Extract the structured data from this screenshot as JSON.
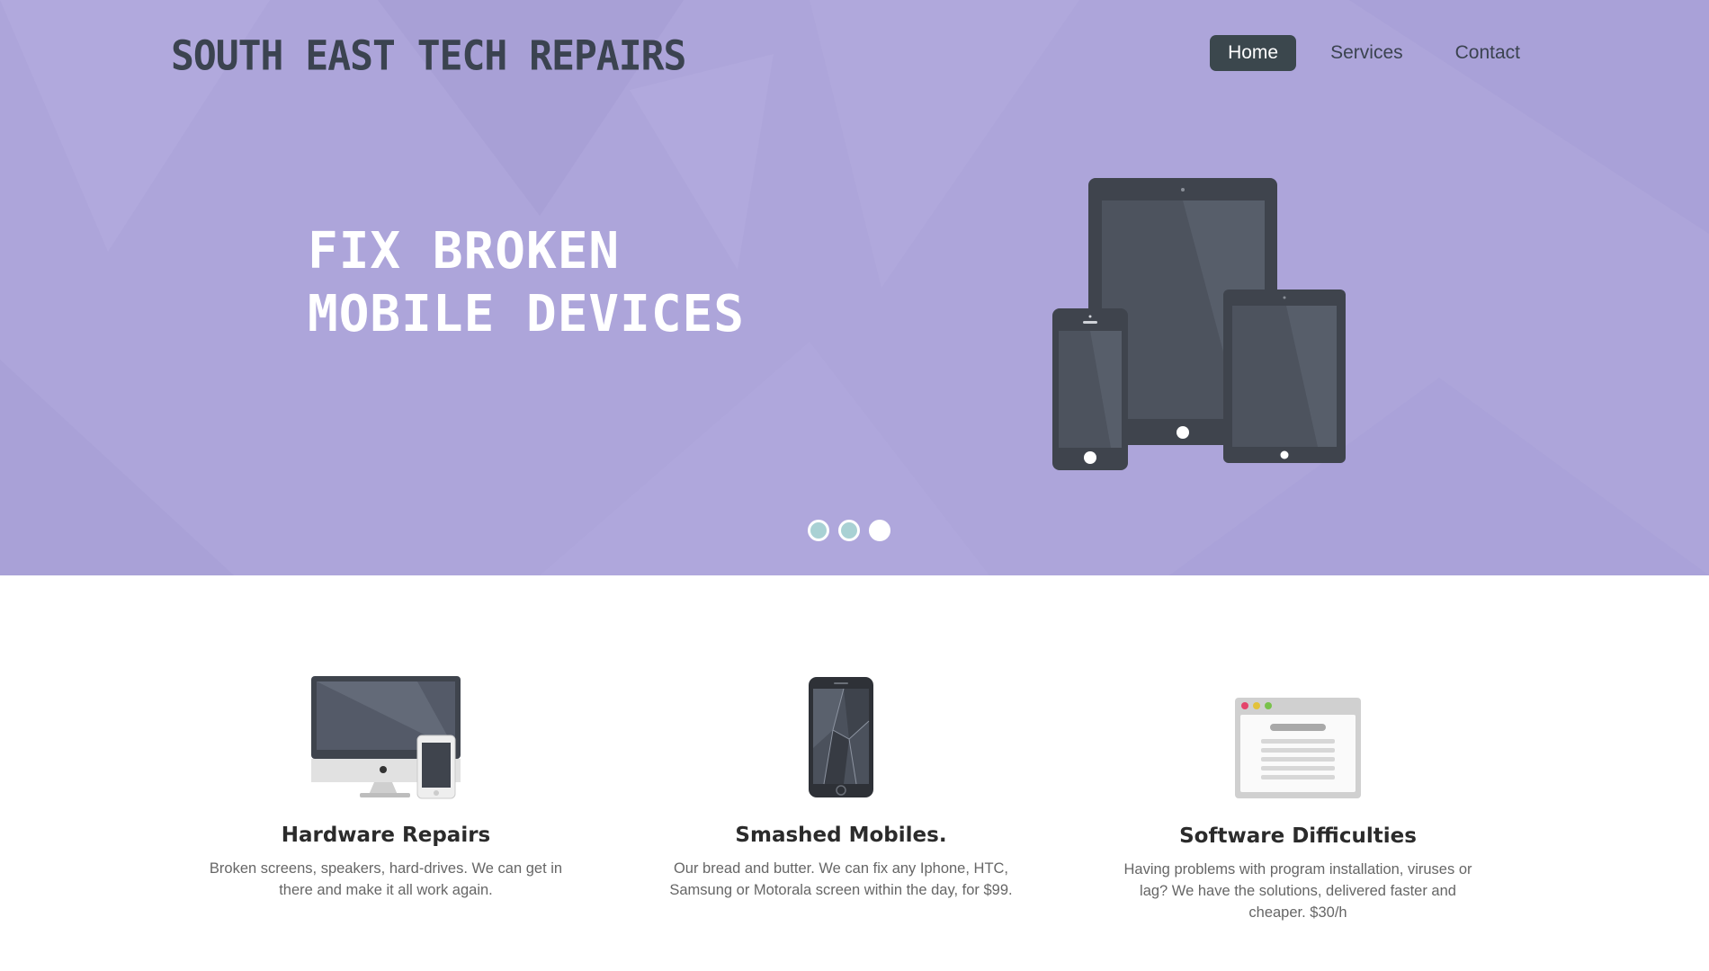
{
  "header": {
    "brand": "SOUTH EAST TECH REPAIRS",
    "nav": [
      {
        "label": "Home",
        "active": true
      },
      {
        "label": "Services",
        "active": false
      },
      {
        "label": "Contact",
        "active": false
      }
    ]
  },
  "hero": {
    "headline_line1": "FIX BROKEN",
    "headline_line2": "MOBILE DEVICES",
    "illustration_icon": "devices-icon",
    "slider": {
      "count": 3,
      "active_index": 2
    },
    "colors": {
      "background": "#ada5da",
      "headline": "#ffffff",
      "dot": "#a9d1d4"
    }
  },
  "features": [
    {
      "icon": "desktop-and-phone-icon",
      "title": "Hardware Repairs",
      "text": "Broken screens, speakers, hard-drives. We can get in there and make it all work again."
    },
    {
      "icon": "smashed-phone-icon",
      "title": "Smashed Mobiles.",
      "text": "Our bread and butter. We can fix any Iphone, HTC, Samsung or Motorala screen within the day, for $99."
    },
    {
      "icon": "browser-window-icon",
      "title": "Software Difficulties",
      "text": "Having problems with program installation, viruses or lag? We have the solutions, delivered faster and cheaper. $30/h"
    }
  ],
  "colors": {
    "brand_text": "#3b4350",
    "active_nav": "#3b474d",
    "body_text": "#666666",
    "heading_text": "#2b2b2b"
  }
}
